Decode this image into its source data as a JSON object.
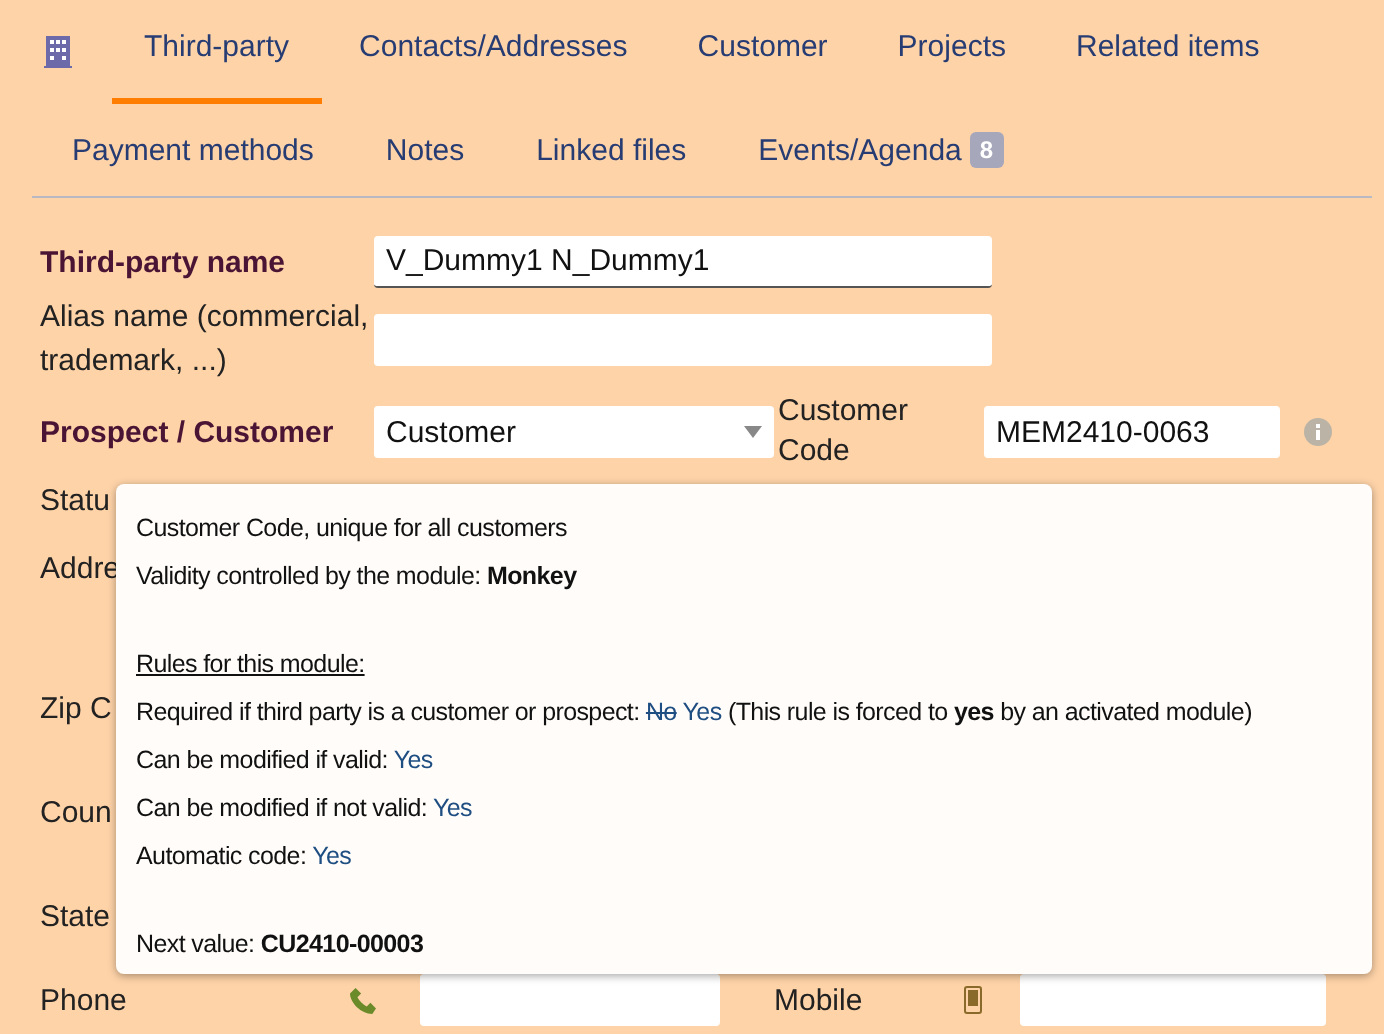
{
  "tabs": [
    {
      "label": "Third-party",
      "selected": true
    },
    {
      "label": "Contacts/Addresses",
      "selected": false
    },
    {
      "label": "Customer",
      "selected": false
    },
    {
      "label": "Projects",
      "selected": false
    },
    {
      "label": "Related items",
      "selected": false
    }
  ],
  "subtabs": [
    {
      "label": "Payment methods",
      "selected": false
    },
    {
      "label": "Notes",
      "selected": false
    },
    {
      "label": "Linked files",
      "selected": false
    },
    {
      "label": "Events/Agenda",
      "selected": false,
      "badge": "8"
    }
  ],
  "form": {
    "name_label": "Third-party name",
    "name_value": "V_Dummy1 N_Dummy1",
    "alias_label": "Alias name (commercial, trademark, ...)",
    "prospect_label": "Prospect / Customer",
    "prospect_value": "Customer",
    "code_label": "Customer Code",
    "code_value": "MEM2410-0063",
    "covered_labels": [
      "Statu",
      "Addre",
      "Zip C",
      "Coun",
      "State"
    ],
    "phone_label": "Phone",
    "mobile_label": "Mobile"
  },
  "tooltip": {
    "lines": [
      {
        "kind": "text",
        "text": "Customer Code, unique for all customers"
      },
      {
        "kind": "text",
        "text": "Validity controlled by the module: **Monkey**"
      },
      {
        "kind": "heading",
        "text": "Rules for this module:"
      },
      {
        "kind": "forced",
        "label": "Required if third party is a customer or prospect:",
        "old_value": "No",
        "value": "Yes",
        "note": "(This rule is forced to **yes** by an activated module)"
      },
      {
        "kind": "rule",
        "label": "Can be modified if valid:",
        "value": "Yes"
      },
      {
        "kind": "rule",
        "label": "Can be modified if not valid:",
        "value": "Yes"
      },
      {
        "kind": "rule",
        "label": "Automatic code:",
        "value": "Yes"
      },
      {
        "kind": "next",
        "text": "Next value: **CU2410-00003**"
      }
    ]
  }
}
